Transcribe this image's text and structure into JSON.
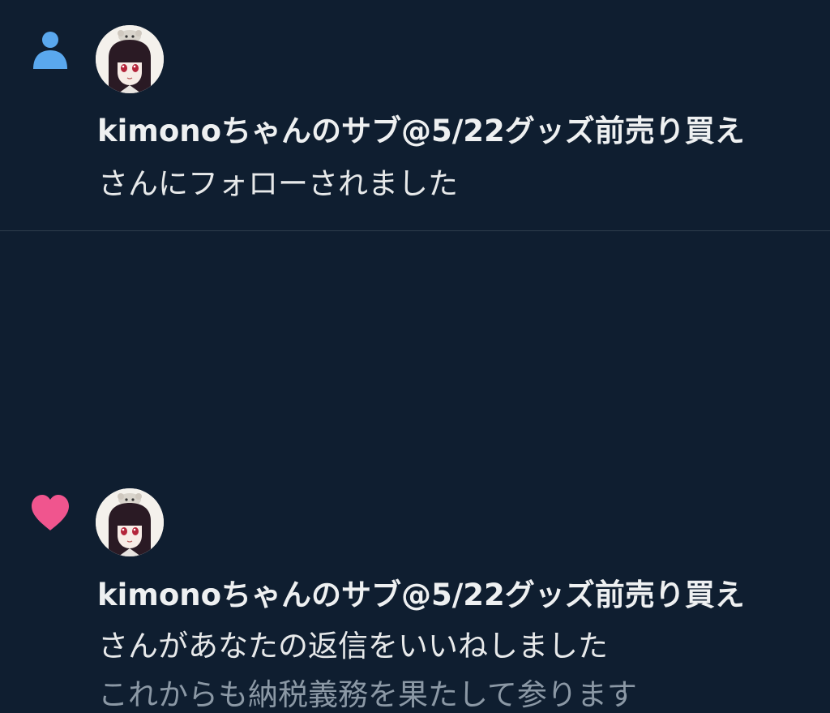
{
  "notifications": [
    {
      "type": "follow",
      "icon": "person-icon",
      "icon_color": "#5aa8ee",
      "user_name": "kimonoちゃんのサブ@5/22グッズ前売り買え",
      "action_text": "さんにフォローされました"
    },
    {
      "type": "like",
      "icon": "heart-icon",
      "icon_color": "#f0558e",
      "user_name": "kimonoちゃんのサブ@5/22グッズ前売り買え",
      "action_text": "さんがあなたの返信をいいねしました",
      "snippet": "これからも納税義務を果たして参ります"
    }
  ],
  "colors": {
    "background": "#0f1e30",
    "divider": "#2f3d4c",
    "primary_text": "#e7e9ea",
    "secondary_text": "#8b98a5"
  }
}
